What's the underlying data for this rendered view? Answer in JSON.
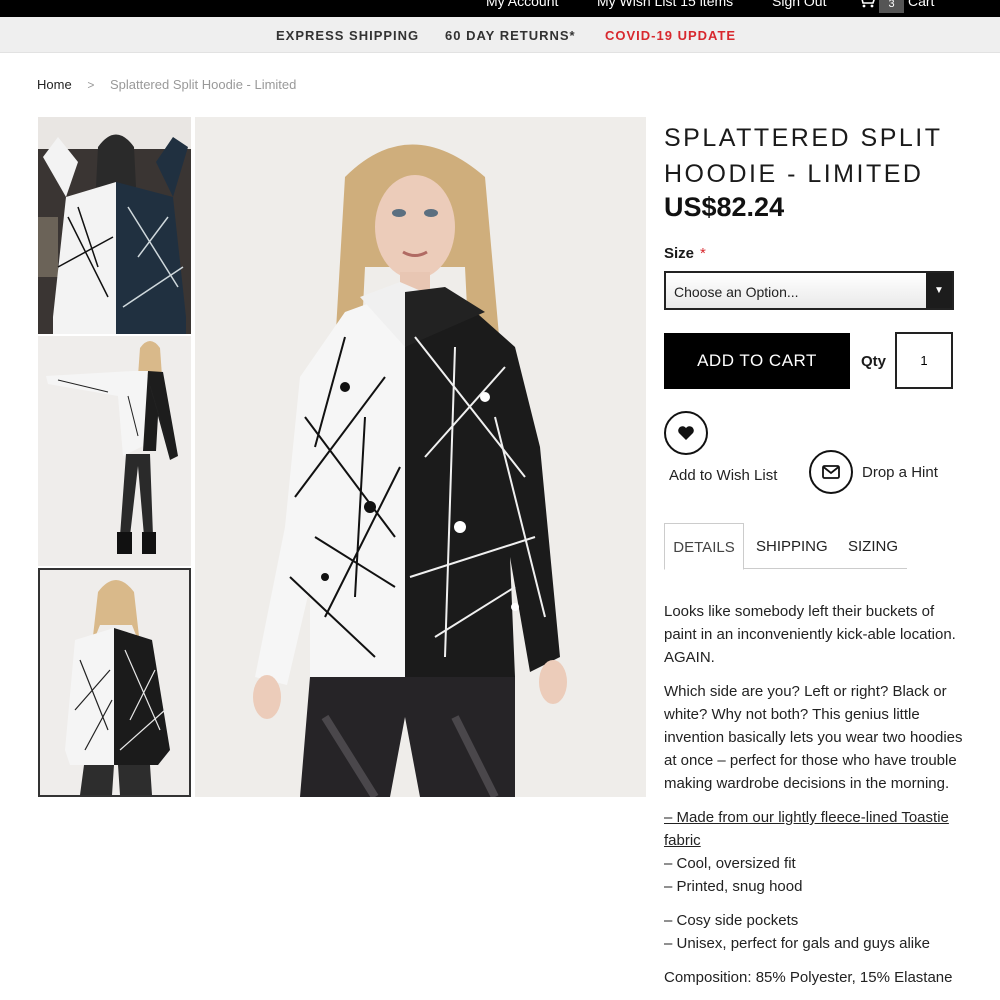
{
  "topbar": {
    "account": "My Account",
    "wishlist": "My Wish List 15 items",
    "signout": "Sign Out",
    "cart_count": "3",
    "cart_label": "Cart"
  },
  "promos": {
    "shipping": "EXPRESS SHIPPING",
    "returns": "60 DAY RETURNS*",
    "covid": "COVID-19 UPDATE"
  },
  "breadcrumb": {
    "home": "Home",
    "separator": ">",
    "current": "Splattered Split Hoodie - Limited"
  },
  "product": {
    "title_line1": "SPLATTERED SPLIT",
    "title_line2": "HOODIE - LIMITED",
    "price": "US$82.24",
    "size_label": "Size",
    "size_required": "*",
    "size_value": "Choose an Option...",
    "add_to_cart": "ADD TO CART",
    "qty_label": "Qty",
    "qty_value": "1",
    "wishlist_label": "Add to Wish List",
    "hint_label": "Drop a Hint"
  },
  "tabs": {
    "details": "DETAILS",
    "shipping": "SHIPPING",
    "sizing": "SIZING"
  },
  "description": {
    "p1": "Looks like somebody left their buckets of paint in an inconveniently kick-able location. AGAIN.",
    "p2": "Which side are you? Left or right? Black or white? Why not both? This genius little invention basically lets you wear two hoodies at once – perfect for those who have trouble making wardrobe decisions in the morning.",
    "fabric_link": "– Made from our lightly fleece-lined Toastie fabric",
    "bullet_fit": "– Cool, oversized fit",
    "bullet_hood": "– Printed, snug hood",
    "bullet_pockets": "– Cosy side pockets",
    "bullet_unisex": "– Unisex, perfect for gals and guys alike",
    "composition": "Composition: 85% Polyester, 15% Elastane"
  },
  "colors": {
    "accent": "#d8282e",
    "button": "#000000",
    "promo_bg": "#efefef"
  }
}
